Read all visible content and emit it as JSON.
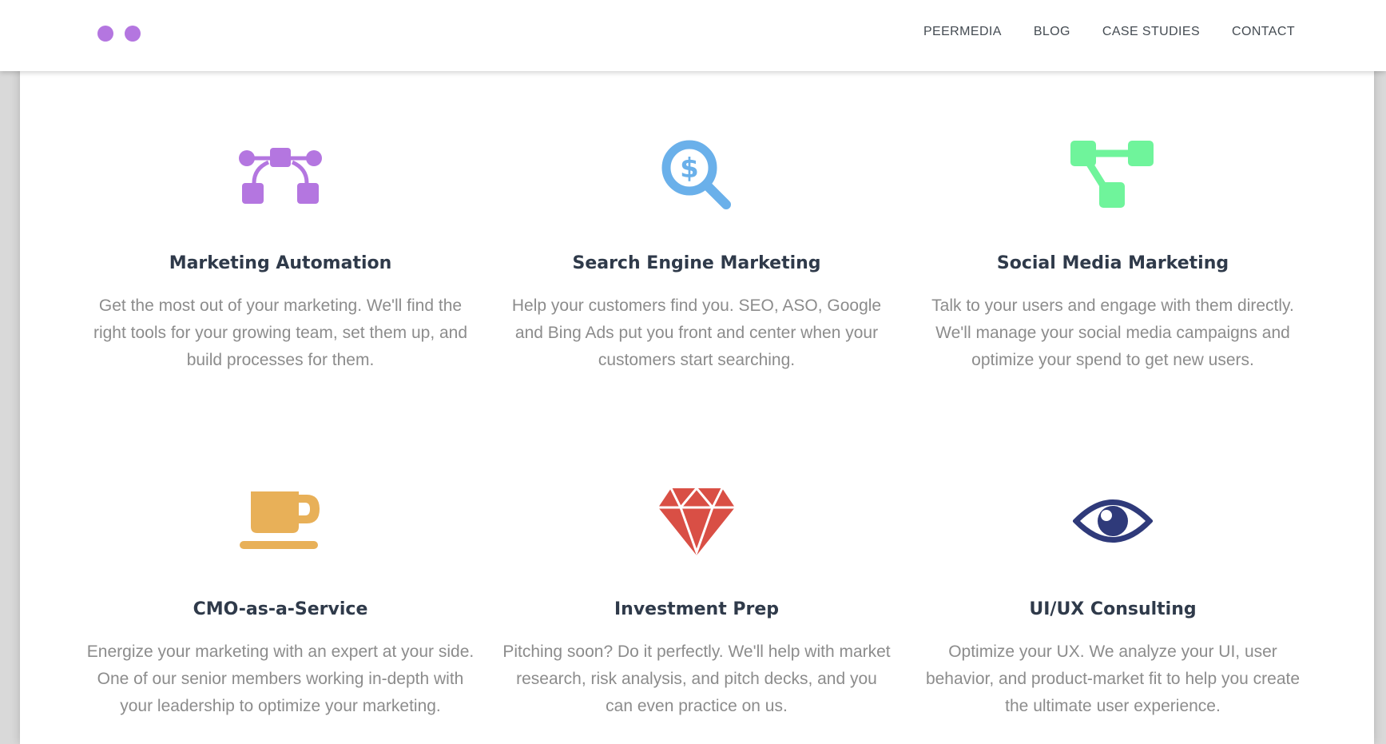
{
  "logo": {
    "dot_color": "#b476e0"
  },
  "nav": {
    "items": [
      "PEERMEDIA",
      "BLOG",
      "CASE STUDIES",
      "CONTACT"
    ]
  },
  "services": [
    {
      "icon": "flow-nodes-icon",
      "color": "#b476e0",
      "title": "Marketing Automation",
      "description": "Get the most out of your marketing. We'll find the right tools for your growing team, set them up, and build processes for them."
    },
    {
      "icon": "dollar-search-icon",
      "color": "#6ab0ea",
      "title": "Search Engine Marketing",
      "description": "Help your customers find you. SEO, ASO, Google and Bing Ads put you front and center when your customers start searching."
    },
    {
      "icon": "network-tree-icon",
      "color": "#6ff49b",
      "title": "Social Media Marketing",
      "description": "Talk to your users and engage with them directly. We'll manage your social media campaigns and optimize your spend to get new users."
    },
    {
      "icon": "coffee-cup-icon",
      "color": "#e8b058",
      "title": "CMO-as-a-Service",
      "description": "Energize your marketing with an expert at your side. One of our senior members working in-depth with your leadership to optimize your marketing."
    },
    {
      "icon": "gem-icon",
      "color": "#d94f45",
      "title": "Investment Prep",
      "description": "Pitching soon? Do it perfectly. We'll help with market research, risk analysis, and pitch decks, and you can even practice on us."
    },
    {
      "icon": "eye-icon",
      "color": "#2f3a7a",
      "title": "UI/UX Consulting",
      "description": "Optimize your UX. We analyze your UI, user behavior, and product-market fit to help you create the ultimate user experience."
    }
  ]
}
